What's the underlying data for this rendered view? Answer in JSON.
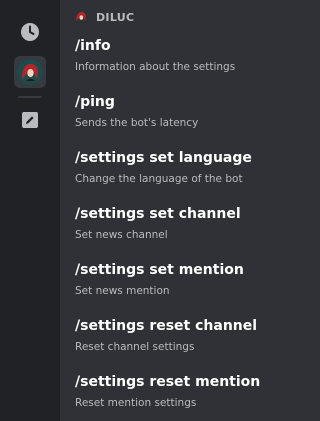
{
  "app": {
    "name": "DILUC"
  },
  "rail": {
    "icons": [
      "clock-icon",
      "bot-avatar",
      "pencil-icon"
    ]
  },
  "commands": [
    {
      "name": "/info",
      "description": "Information about the settings"
    },
    {
      "name": "/ping",
      "description": "Sends the bot's latency"
    },
    {
      "name": "/settings set language",
      "description": "Change the language of the bot"
    },
    {
      "name": "/settings set channel",
      "description": "Set news channel"
    },
    {
      "name": "/settings set mention",
      "description": "Set news mention"
    },
    {
      "name": "/settings reset channel",
      "description": "Reset channel settings"
    },
    {
      "name": "/settings reset mention",
      "description": "Reset mention settings"
    }
  ],
  "colors": {
    "rail_bg": "#202225",
    "panel_bg": "#2f3136",
    "title": "#ffffff",
    "desc": "#b9bbbe"
  }
}
